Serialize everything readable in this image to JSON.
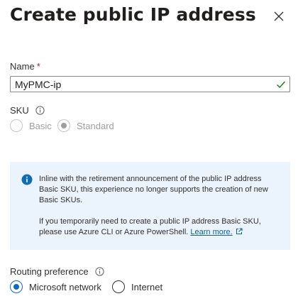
{
  "panel": {
    "title": "Create public IP address",
    "close_icon": "close-icon"
  },
  "name_field": {
    "label": "Name",
    "required_marker": "*",
    "value": "MyPMC-ip",
    "status_icon": "checkmark-icon",
    "status_color": "#107c10"
  },
  "sku": {
    "label": "SKU",
    "info_icon": "info-icon",
    "options": [
      {
        "label": "Basic",
        "selected": false,
        "disabled": true
      },
      {
        "label": "Standard",
        "selected": true,
        "disabled": true
      }
    ]
  },
  "info_banner": {
    "icon": "info-filled-icon",
    "icon_color": "#0f6cbd",
    "background": "#ebf3fc",
    "paragraph1": "Inline with the retirement announcement of the public IP address Basic SKU, this experience no longer supports the creation of new Basic SKUs.",
    "paragraph2": "If you temporarily need to create a public IP address Basic SKU, please use Azure CLI or Azure PowerShell.",
    "link_label": "Learn more.",
    "link_icon": "external-link-icon"
  },
  "routing": {
    "label": "Routing preference",
    "info_icon": "info-icon",
    "options": [
      {
        "label": "Microsoft network",
        "selected": true
      },
      {
        "label": "Internet",
        "selected": false
      }
    ]
  },
  "colors": {
    "accent": "#0f6cbd",
    "text": "#323130",
    "disabled": "#a19f9d",
    "required": "#a4262c"
  }
}
